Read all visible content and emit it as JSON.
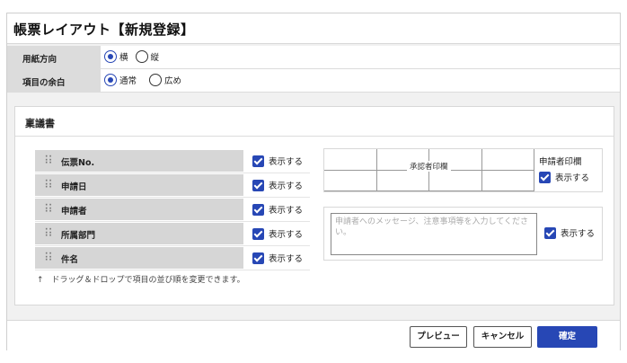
{
  "page": {
    "title": "帳票レイアウト【新規登録】"
  },
  "form": {
    "paper": {
      "label": "用紙方向",
      "options": [
        "横",
        "縦"
      ],
      "selected": "横"
    },
    "margin": {
      "label": "項目の余白",
      "options": [
        "通常",
        "広め"
      ],
      "selected": "通常"
    }
  },
  "section": {
    "title": "稟議書"
  },
  "items": [
    {
      "label": "伝票No.",
      "show_label": "表示する",
      "checked": true
    },
    {
      "label": "申請日",
      "show_label": "表示する",
      "checked": true
    },
    {
      "label": "申請者",
      "show_label": "表示する",
      "checked": true
    },
    {
      "label": "所属部門",
      "show_label": "表示する",
      "checked": true
    },
    {
      "label": "件名",
      "show_label": "表示する",
      "checked": true
    }
  ],
  "hint": "↑　ドラッグ＆ドロップで項目の並び順を変更できます。",
  "stamp": {
    "caption": "承認者印欄",
    "applicant_label": "申請者印欄",
    "show_label": "表示する",
    "checked": true
  },
  "message": {
    "placeholder": "申請者へのメッセージ、注意事項等を入力してください。",
    "show_label": "表示する",
    "checked": true
  },
  "footer": {
    "preview": "プレビュー",
    "cancel": "キャンセル",
    "confirm": "確定"
  },
  "colors": {
    "accent": "#2747b5",
    "label_bg": "#dcdcdc",
    "window_bg": "#f1f1f1"
  }
}
